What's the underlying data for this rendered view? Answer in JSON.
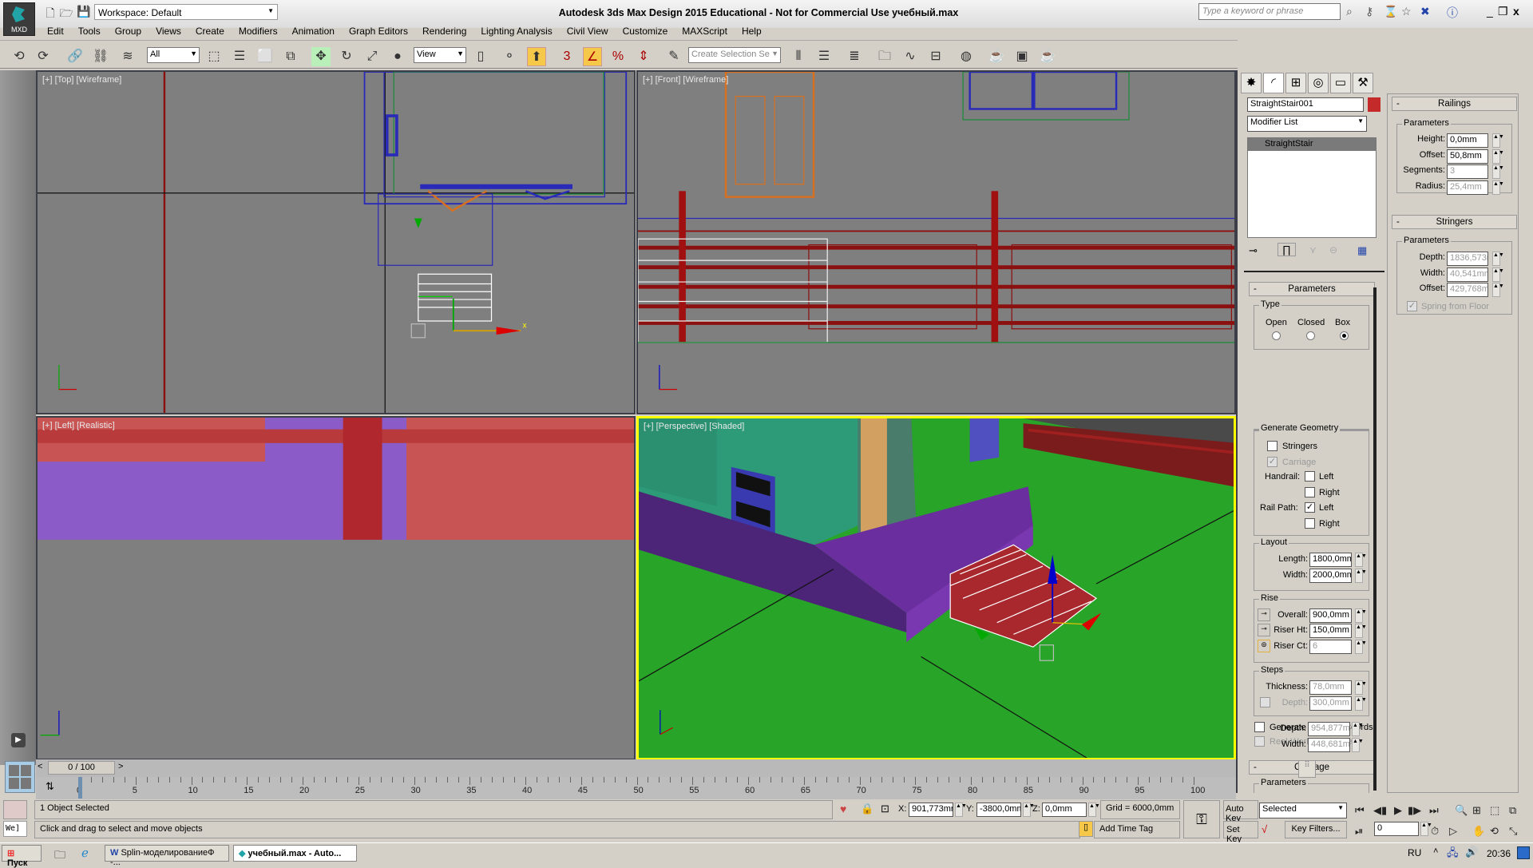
{
  "title_bar": {
    "app_badge": "MXD",
    "workspace": "Workspace: Default",
    "title": "Autodesk 3ds Max Design 2015  Educational - Not for Commercial Use    учебный.max",
    "search_placeholder": "Type a keyword or phrase"
  },
  "menu": [
    "Edit",
    "Tools",
    "Group",
    "Views",
    "Create",
    "Modifiers",
    "Animation",
    "Graph Editors",
    "Rendering",
    "Lighting Analysis",
    "Civil View",
    "Customize",
    "MAXScript",
    "Help"
  ],
  "toolbar": {
    "selection_filter": "All",
    "ref_coord": "View",
    "named_selection_placeholder": "Create Selection Se",
    "snap_label": "3"
  },
  "viewports": {
    "top": {
      "label": "[+] [Top] [Wireframe]"
    },
    "front": {
      "label": "[+] [Front] [Wireframe]"
    },
    "left": {
      "label": "[+] [Left] [Realistic]"
    },
    "perspective": {
      "label": "[+] [Perspective] [Shaded]"
    }
  },
  "command_panel": {
    "object_name": "StraightStair001",
    "object_color": "#c42a2a",
    "modifier_list": "Modifier List",
    "stack_item": "StraightStair",
    "parameters": {
      "title": "Parameters",
      "type_group": "Type",
      "type_options": [
        "Open",
        "Closed",
        "Box"
      ],
      "type_selected": "Box",
      "generate_group": "Generate Geometry",
      "stringers": "Stringers",
      "carriage": "Carriage",
      "handrail": "Handrail:",
      "rail_path": "Rail Path:",
      "left": "Left",
      "right": "Right",
      "layout_group": "Layout",
      "length_label": "Length:",
      "length": "1800,0mm",
      "width_label": "Width:",
      "width": "2000,0mm",
      "rise_group": "Rise",
      "overall_label": "Overall:",
      "overall": "900,0mm",
      "riser_ht_label": "Riser Ht:",
      "riser_ht": "150,0mm",
      "riser_ct_label": "Riser Ct:",
      "riser_ct": "6",
      "steps_group": "Steps",
      "thickness_label": "Thickness:",
      "thickness": "78,0mm",
      "depth_label": "Depth:",
      "depth": "300,0mm",
      "gen_mapping": "Generate Mapping Coords.",
      "real_world": "Real-World Map Size"
    },
    "carriage": {
      "title": "Carriage",
      "params": "Parameters",
      "depth_label": "Depth:",
      "depth": "954,877m",
      "width_label": "Width:",
      "width": "448,681m"
    },
    "railings": {
      "title": "Railings",
      "params": "Parameters",
      "height_label": "Height:",
      "height": "0,0mm",
      "offset_label": "Offset:",
      "offset": "50,8mm",
      "segments_label": "Segments:",
      "segments": "3",
      "radius_label": "Radius:",
      "radius": "25,4mm"
    },
    "stringers": {
      "title": "Stringers",
      "params": "Parameters",
      "depth_label": "Depth:",
      "depth": "1836,573r",
      "width_label": "Width:",
      "width": "40,541mm",
      "offset_label": "Offset:",
      "offset": "429,768m",
      "spring": "Spring from Floor"
    }
  },
  "timeline": {
    "frame_counter": "0 / 100",
    "ticks": [
      "0",
      "5",
      "10",
      "15",
      "20",
      "25",
      "30",
      "35",
      "40",
      "45",
      "50",
      "55",
      "60",
      "65",
      "70",
      "75",
      "80",
      "85",
      "90",
      "95",
      "100"
    ]
  },
  "status": {
    "selection": "1 Object Selected",
    "prompt": "Click and drag to select and move objects",
    "maxscript": "We]",
    "x_label": "X:",
    "x": "901,773mr",
    "y_label": "Y:",
    "y": "-3800,0mm",
    "z_label": "Z:",
    "z": "0,0mm",
    "grid": "Grid = 6000,0mm",
    "add_time_tag": "Add Time Tag",
    "auto_key": "Auto Key",
    "set_key": "Set Key",
    "key_mode": "Selected",
    "key_filters": "Key Filters...",
    "current_frame": "0"
  },
  "taskbar": {
    "start": "Пуск",
    "tasks": [
      "Splin-моделированиеФ -...",
      "учебный.max - Auto..."
    ],
    "lang": "RU",
    "clock": "20:36"
  }
}
